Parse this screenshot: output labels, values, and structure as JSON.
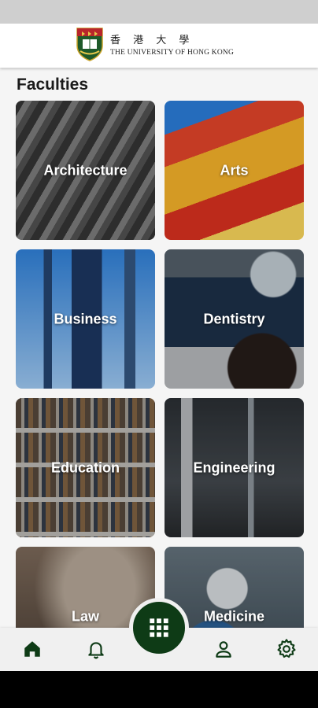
{
  "header": {
    "chinese_name": "香 港 大 學",
    "english_name": "THE UNIVERSITY OF HONG KONG"
  },
  "faculties": {
    "title": "Faculties",
    "items": [
      {
        "label": "Architecture"
      },
      {
        "label": "Arts"
      },
      {
        "label": "Business"
      },
      {
        "label": "Dentistry"
      },
      {
        "label": "Education"
      },
      {
        "label": "Engineering"
      },
      {
        "label": "Law"
      },
      {
        "label": "Medicine"
      }
    ]
  },
  "bottom_nav": {
    "items": [
      {
        "icon": "home-icon",
        "active": true
      },
      {
        "icon": "bell-icon",
        "active": false
      },
      {
        "icon": "grid-icon",
        "active": false
      },
      {
        "icon": "person-icon",
        "active": false
      },
      {
        "icon": "gear-icon",
        "active": false
      }
    ],
    "accent": "#0e3b16"
  }
}
